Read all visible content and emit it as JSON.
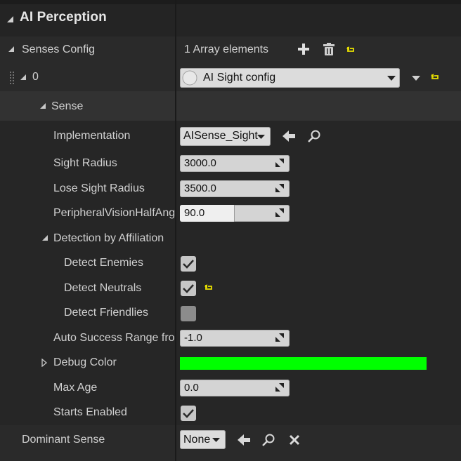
{
  "section_title": "AI Perception",
  "senses_config": {
    "label": "Senses Config",
    "array_count_text": "1 Array elements"
  },
  "element0": {
    "index_label": "0",
    "config_value": "AI Sight config"
  },
  "sense": {
    "label": "Sense",
    "implementation": {
      "label": "Implementation",
      "value": "AISense_Sight"
    },
    "sight_radius": {
      "label": "Sight Radius",
      "value": "3000.0"
    },
    "lose_sight_radius": {
      "label": "Lose Sight Radius",
      "value": "3500.0"
    },
    "peripheral_vision": {
      "label": "PeripheralVisionHalfAng",
      "value": "90.0"
    },
    "detection_by_affiliation": {
      "label": "Detection by Affiliation",
      "detect_enemies": {
        "label": "Detect Enemies",
        "checked": true
      },
      "detect_neutrals": {
        "label": "Detect Neutrals",
        "checked": true
      },
      "detect_friendlies": {
        "label": "Detect Friendlies",
        "checked": false
      }
    },
    "auto_success_range": {
      "label": "Auto Success Range fror",
      "value": "-1.0"
    },
    "debug_color": {
      "label": "Debug Color",
      "color": "#00ff00"
    },
    "max_age": {
      "label": "Max Age",
      "value": "0.0"
    },
    "starts_enabled": {
      "label": "Starts Enabled",
      "checked": true
    }
  },
  "dominant_sense": {
    "label": "Dominant Sense",
    "value": "None"
  },
  "colors": {
    "panel_bg": "#242424",
    "reset_arrow": "#e8e000",
    "debug_color": "#00ff00"
  }
}
